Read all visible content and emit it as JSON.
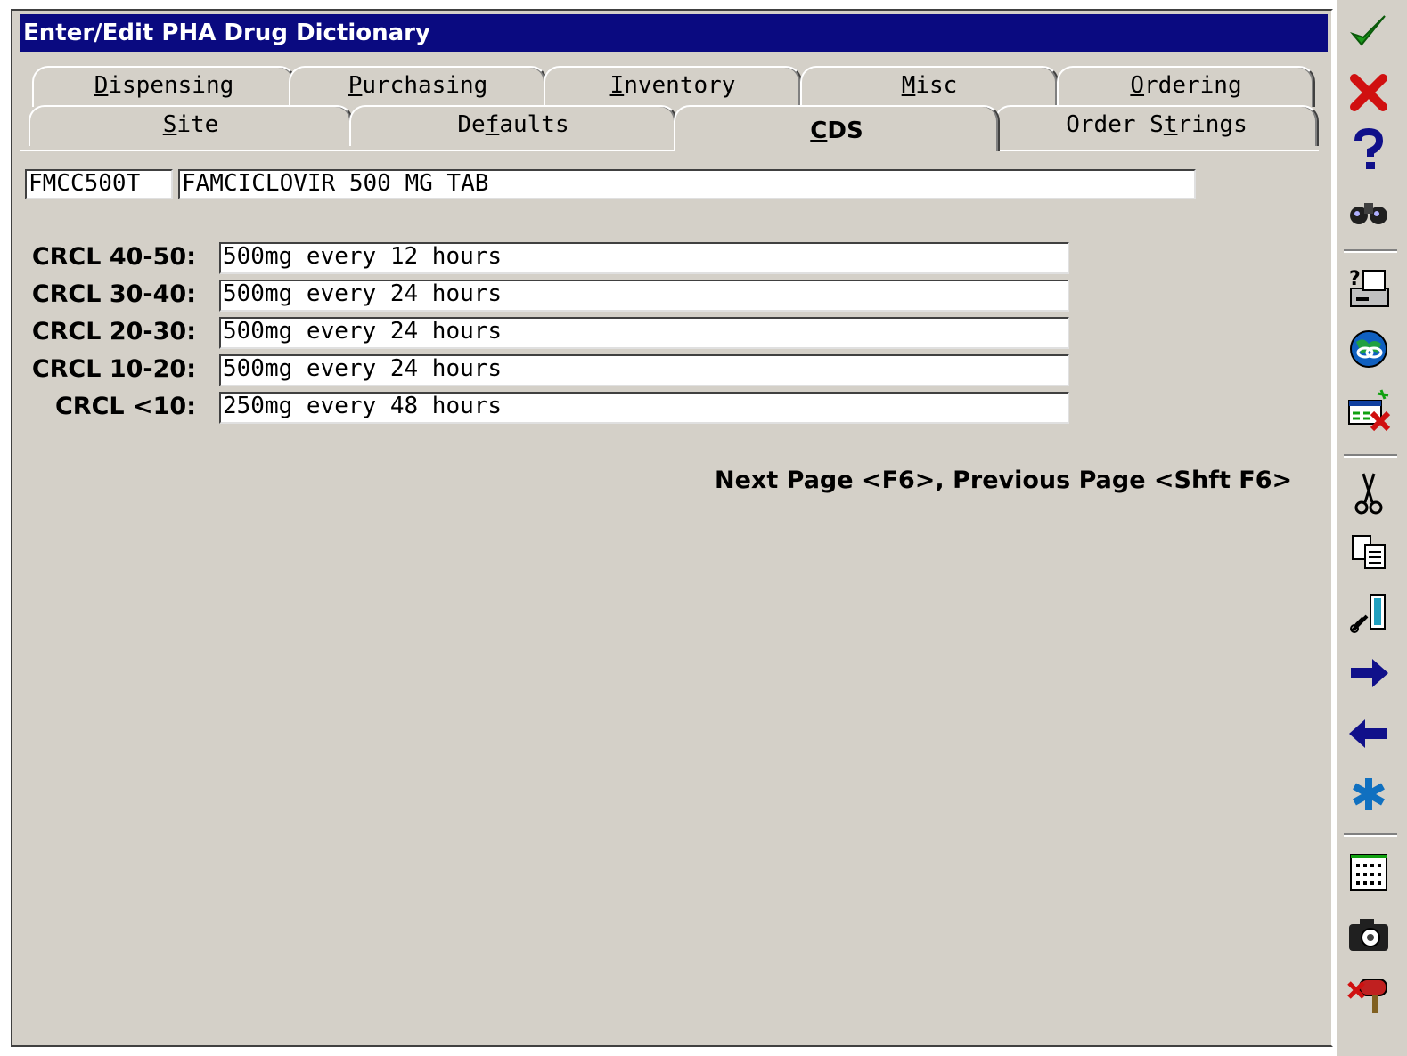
{
  "window": {
    "title": "Enter/Edit PHA Drug Dictionary"
  },
  "tabs_back": [
    {
      "pre": "",
      "u": "D",
      "post": "ispensing"
    },
    {
      "pre": "",
      "u": "P",
      "post": "urchasing"
    },
    {
      "pre": "",
      "u": "I",
      "post": "nventory"
    },
    {
      "pre": "",
      "u": "M",
      "post": "isc"
    },
    {
      "pre": "",
      "u": "O",
      "post": "rdering"
    }
  ],
  "tabs_front": [
    {
      "pre": "",
      "u": "S",
      "post": "ite"
    },
    {
      "pre": "De",
      "u": "f",
      "post": "aults"
    },
    {
      "pre": "",
      "u": "C",
      "post": "DS"
    },
    {
      "pre": "Order S",
      "u": "t",
      "post": "rings"
    }
  ],
  "drug": {
    "code": "FMCC500T",
    "name": "FAMCICLOVIR 500 MG TAB"
  },
  "crcl": [
    {
      "label": "CRCL 40-50:",
      "value": "500mg every 12 hours"
    },
    {
      "label": "CRCL 30-40:",
      "value": "500mg every 24 hours"
    },
    {
      "label": "CRCL 20-30:",
      "value": "500mg every 24 hours"
    },
    {
      "label": "CRCL 10-20:",
      "value": "500mg every 24 hours"
    },
    {
      "label": "CRCL <10:",
      "value": "250mg every 48 hours"
    }
  ],
  "hint": "Next Page <F6>, Previous Page <Shft F6>",
  "toolbar_icons": [
    "checkmark-icon",
    "cancel-x-icon",
    "help-question-icon",
    "binoculars-find-icon",
    "print-help-icon",
    "globe-link-icon",
    "delete-table-icon",
    "cut-scissors-icon",
    "copy-icon",
    "paste-icon",
    "next-arrow-icon",
    "previous-arrow-icon",
    "asterisk-icon",
    "calculator-icon",
    "camera-icon",
    "exit-mailbox-icon"
  ],
  "colors": {
    "titlebar": "#0a0a80",
    "face": "#d4d0c8",
    "check": "#1a9a1a",
    "cancel": "#d01010",
    "arrow": "#10108a"
  }
}
